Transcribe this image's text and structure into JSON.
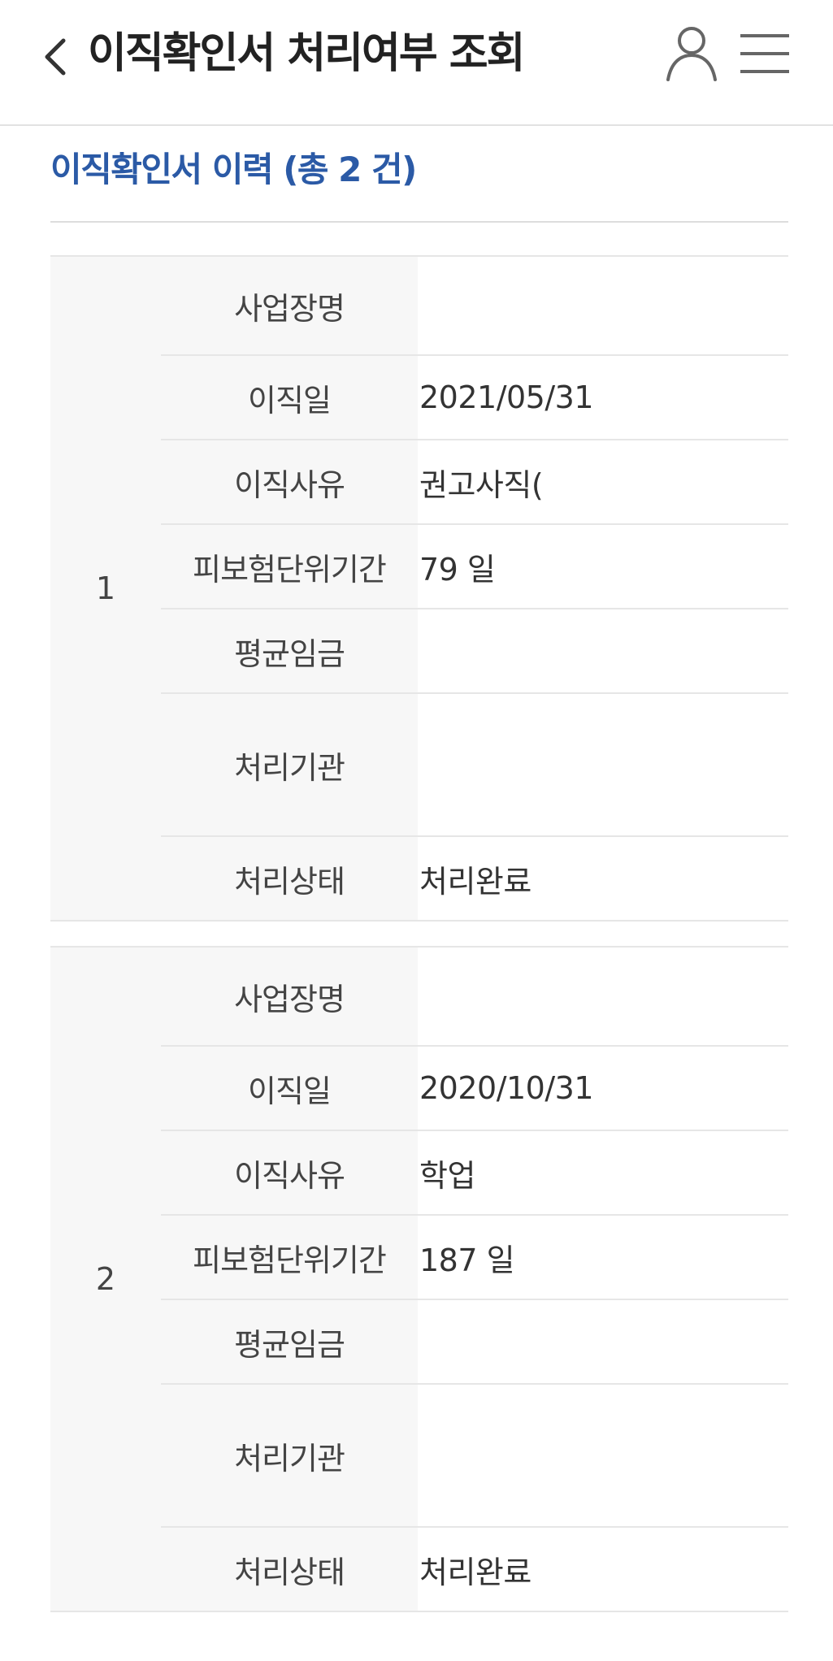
{
  "header": {
    "title": "이직확인서 처리여부 조회",
    "icons": [
      "back-chevron-icon",
      "user-icon",
      "hamburger-menu-icon"
    ]
  },
  "section": {
    "title": "이직확인서 이력 (총 2 건)"
  },
  "records": [
    {
      "number": "1",
      "rows": [
        {
          "label": "사업장명",
          "value": ""
        },
        {
          "label": "이직일",
          "value": "2021/05/31"
        },
        {
          "label": "이직사유",
          "value": "권고사직("
        },
        {
          "label": "피보험단위기간",
          "value": "79 일"
        },
        {
          "label": "평균임금",
          "value": ""
        },
        {
          "label": "처리기관",
          "value": ""
        },
        {
          "label": "처리상태",
          "value": "처리완료"
        }
      ]
    },
    {
      "number": "2",
      "rows": [
        {
          "label": "사업장명",
          "value": ""
        },
        {
          "label": "이직일",
          "value": "2020/10/31"
        },
        {
          "label": "이직사유",
          "value": "학업"
        },
        {
          "label": "피보험단위기간",
          "value": "187 일"
        },
        {
          "label": "평균임금",
          "value": ""
        },
        {
          "label": "처리기관",
          "value": ""
        },
        {
          "label": "처리상태",
          "value": "처리완료"
        }
      ]
    }
  ],
  "colors": {
    "accent": "#2b5aa6",
    "label_background": "#f7f7f7",
    "divider": "#e6e6e6"
  }
}
